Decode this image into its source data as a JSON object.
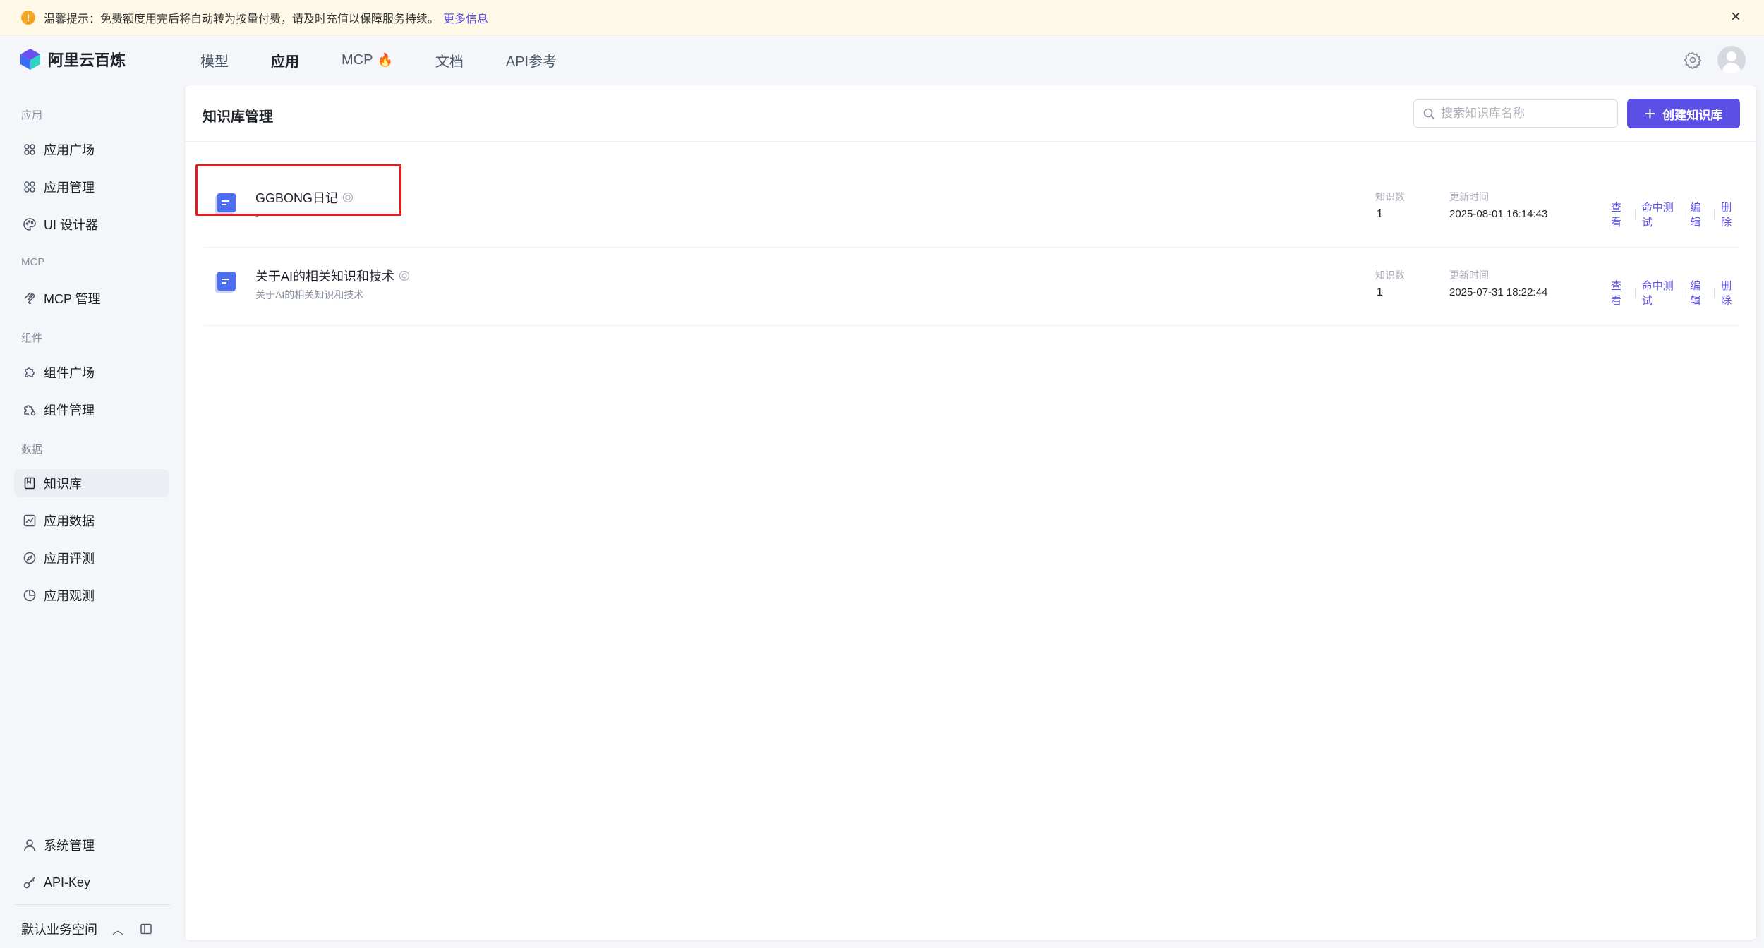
{
  "notice": {
    "text": "温馨提示：免费额度用完后将自动转为按量付费，请及时充值以保障服务持续。",
    "more_link": "更多信息",
    "warn_glyph": "!",
    "close_glyph": "×"
  },
  "header": {
    "logo_text": "阿里云百炼",
    "nav": [
      {
        "label": "模型"
      },
      {
        "label": "应用"
      },
      {
        "label": "MCP"
      },
      {
        "label": "文档"
      },
      {
        "label": "API参考"
      }
    ],
    "active_nav": "应用",
    "accent_color": "#5b4fe6"
  },
  "sidebar": {
    "groups": {
      "app": "应用",
      "mcp": "MCP",
      "component": "组件",
      "data": "数据"
    },
    "items": [
      {
        "label": "应用广场",
        "icon": "grid-icon"
      },
      {
        "label": "应用管理",
        "icon": "grid-icon"
      },
      {
        "label": "UI 设计器",
        "icon": "palette-icon"
      },
      {
        "label": "MCP 管理",
        "icon": "mcp-icon"
      },
      {
        "label": "组件广场",
        "icon": "puzzle-icon"
      },
      {
        "label": "组件管理",
        "icon": "puzzle-gear-icon"
      },
      {
        "label": "知识库",
        "icon": "book-icon",
        "active": true
      },
      {
        "label": "应用数据",
        "icon": "chart-icon"
      },
      {
        "label": "应用评测",
        "icon": "compass-icon"
      },
      {
        "label": "应用观测",
        "icon": "pie-icon"
      }
    ],
    "bottom": [
      {
        "label": "系统管理",
        "icon": "user-icon"
      },
      {
        "label": "API-Key",
        "icon": "key-icon"
      }
    ],
    "workspace": "默认业务空间",
    "workspace_chevron": "︿"
  },
  "main": {
    "title": "知识库管理",
    "search_placeholder": "搜索知识库名称",
    "create_button": "创建知识库",
    "create_plus": "+",
    "count_label": "知识数",
    "time_label": "更新时间",
    "actions": [
      "查看",
      "命中测试",
      "编辑",
      "删除"
    ],
    "rows": [
      {
        "name": "GGBONG日记",
        "desc": "-",
        "count": "1",
        "updated": "2025-08-01 16:14:43"
      },
      {
        "name": "关于AI的相关知识和技术",
        "desc": "关于AI的相关知识和技术",
        "count": "1",
        "updated": "2025-07-31 18:22:44"
      }
    ]
  }
}
